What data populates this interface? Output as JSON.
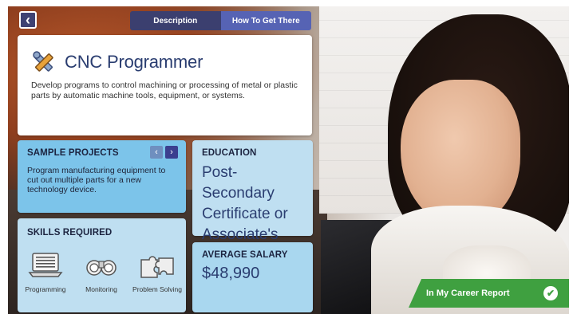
{
  "nav": {
    "back_icon": "chevron-left-icon"
  },
  "tabs": [
    {
      "label": "Description",
      "active": false
    },
    {
      "label": "How To Get There",
      "active": true
    }
  ],
  "career": {
    "title": "CNC Programmer",
    "icon": "tools-icon",
    "description": "Develop programs to control machining or processing of metal or plastic parts by automatic machine tools, equipment, or systems."
  },
  "sample_projects": {
    "heading": "SAMPLE PROJECTS",
    "text": "Program manufacturing equipment to cut out multiple parts for a new technology device."
  },
  "skills": {
    "heading": "SKILLS REQUIRED",
    "items": [
      {
        "label": "Programming",
        "icon": "laptop-code-icon"
      },
      {
        "label": "Monitoring",
        "icon": "binoculars-icon"
      },
      {
        "label": "Problem Solving",
        "icon": "puzzle-icon"
      }
    ]
  },
  "education": {
    "heading": "EDUCATION",
    "value": "Post-Secondary Certificate or Associate's Degree"
  },
  "salary": {
    "heading": "AVERAGE SALARY",
    "value": "$48,990"
  },
  "report_button": {
    "label": "In My Career Report",
    "icon": "checkmark-icon"
  },
  "colors": {
    "navy": "#3b3f6f",
    "tab_active": "#5663b4",
    "title_blue": "#2a3d70",
    "panel_blue": "#7cc4ea",
    "panel_light": "#bfdff1",
    "green": "#3fa040"
  }
}
